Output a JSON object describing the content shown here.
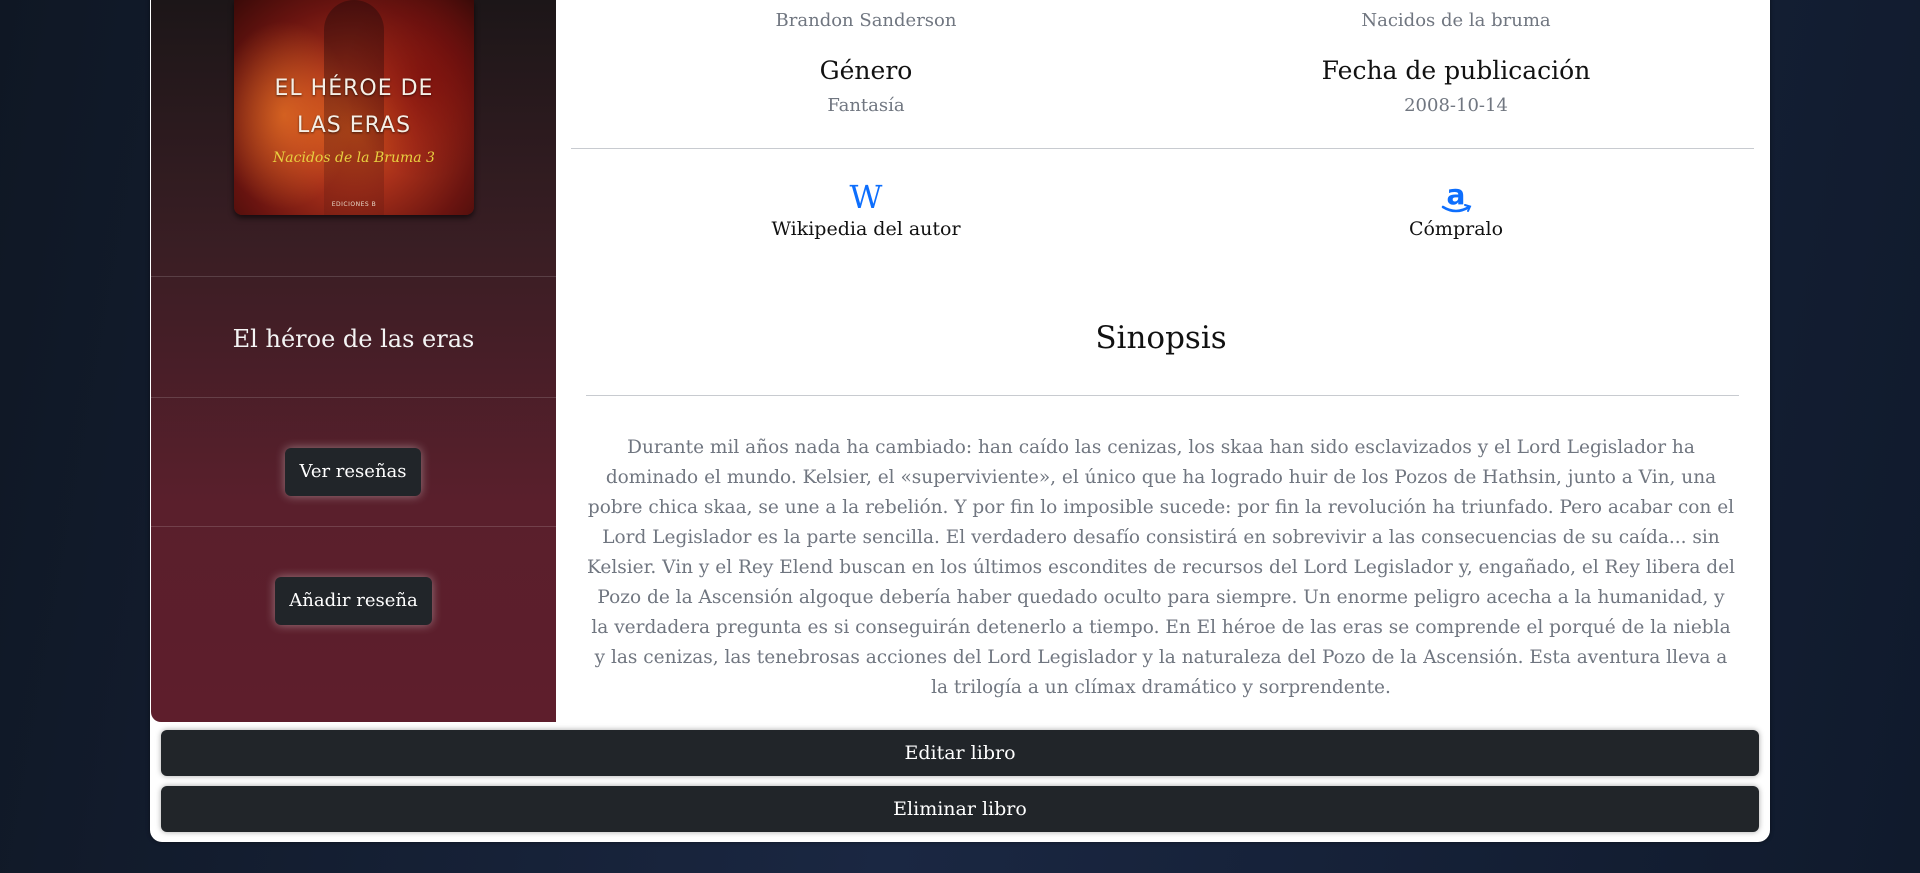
{
  "book": {
    "title": "El héroe de las eras",
    "cover": {
      "title_line1": "EL HÉROE DE",
      "title_line2": "LAS ERAS",
      "series_text": "Nacidos de la Bruma 3",
      "publisher_text": "EDICIONES B"
    }
  },
  "sidebar": {
    "view_reviews_label": "Ver reseñas",
    "add_review_label": "Añadir reseña"
  },
  "details": {
    "author_value": "Brandon Sanderson",
    "saga_value": "Nacidos de la bruma",
    "genre_label": "Género",
    "genre_value": "Fantasía",
    "date_label": "Fecha de publicación",
    "date_value": "2008-10-14"
  },
  "links": {
    "wiki_icon": "W",
    "wiki_label": "Wikipedia del autor",
    "amazon_label": "Cómpralo"
  },
  "synopsis": {
    "heading": "Sinopsis",
    "text": "Durante mil años nada ha cambiado: han caído las cenizas, los skaa han sido esclavizados y el Lord Legislador ha dominado el mundo. Kelsier, el «superviviente», el único que ha logrado huir de los Pozos de Hathsin, junto a Vin, una pobre chica skaa, se une a la rebelión. Y por fin lo imposible sucede: por fin la revolución ha triunfado. Pero acabar con el Lord Legislador es la parte sencilla. El verdadero desafío consistirá en sobrevivir a las consecuencias de su caída... sin Kelsier. Vin y el Rey Elend buscan en los últimos escondites de recursos del Lord Legislador y, engañado, el Rey libera del Pozo de la Ascensión algoque debería haber quedado oculto para siempre. Un enorme peligro acecha a la humanidad, y la verdadera pregunta es si conseguirán detenerlo a tiempo. En El héroe de las eras se comprende el porqué de la niebla y las cenizas, las tenebrosas acciones del Lord Legislador y la naturaleza del Pozo de la Ascensión. Esta aventura lleva a la trilogía a un clímax dramático y sorprendente."
  },
  "actions": {
    "edit_label": "Editar libro",
    "delete_label": "Eliminar libro"
  },
  "colors": {
    "accent_link": "#0d6efd",
    "button_dark": "#212529",
    "sidebar_wine": "#5e1e2c"
  }
}
